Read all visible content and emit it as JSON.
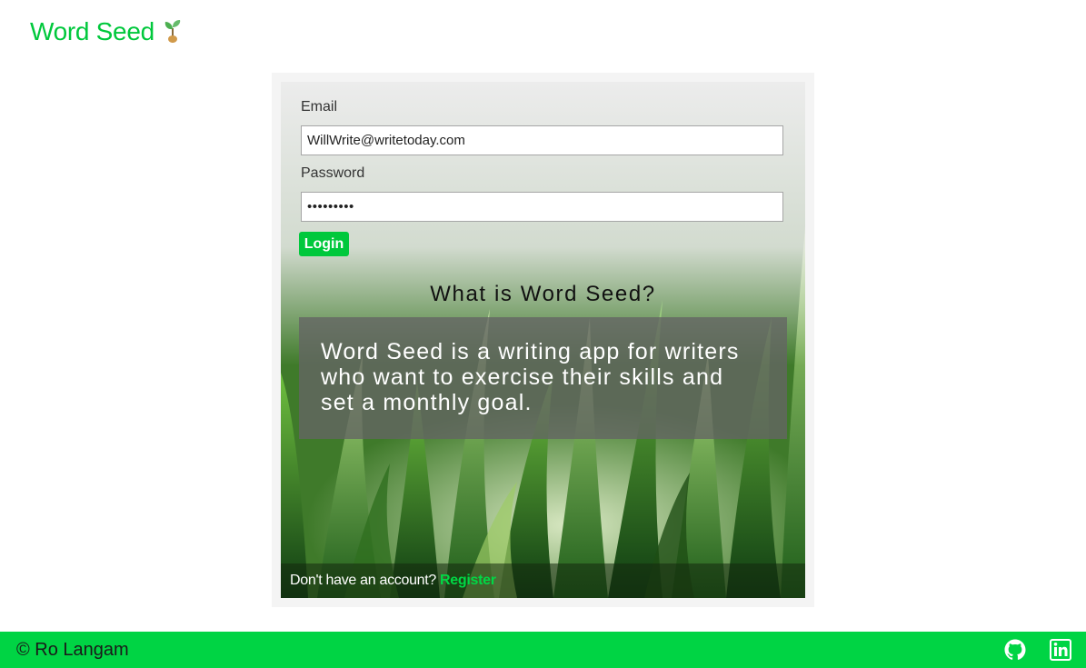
{
  "header": {
    "brand_name": "Word Seed",
    "brand_icon": "sprout-icon"
  },
  "login_form": {
    "email_label": "Email",
    "email_value": "WillWrite@writetoday.com",
    "password_label": "Password",
    "password_value": "•••••••••",
    "login_button": "Login"
  },
  "about": {
    "title": "What is Word Seed?",
    "description": "Word Seed is a writing app for writers who want to exercise their skills and set a monthly goal."
  },
  "register": {
    "prompt": "Don't have an account?",
    "link_label": "Register"
  },
  "footer": {
    "copyright": "© Ro Langam",
    "icons": [
      "github-icon",
      "linkedin-icon"
    ]
  },
  "colors": {
    "accent": "#00c83c",
    "footer_bg": "#00d444",
    "card_bg": "#ececec"
  }
}
